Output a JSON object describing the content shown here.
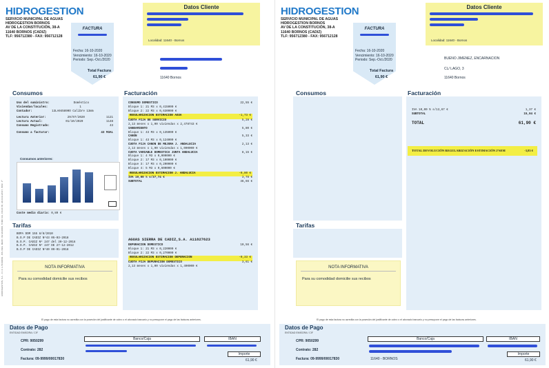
{
  "colors": {
    "brand": "#1f78c8",
    "highlight": "#f3ee44",
    "panel": "#e3eef8",
    "note": "#fbf7c4"
  },
  "header": {
    "logo": "HIDROGESTION",
    "org_lines": [
      "SERVICIO MUNICIPAL DE AGUAS",
      "HIDROGESTION BORNOS",
      "AV DE LA CONSTITUCIÓN, 38-A",
      "11640 BORNOS (CADIZ)",
      "TLF: 956712380 - FAX: 956712128"
    ],
    "factura_title": "FACTURA",
    "fecha": "Fecha: 16-10-2020",
    "vencimiento": "Vencimiento: 16-10-2020",
    "periodo": "Periodo: Sep.-Oct./2020",
    "total_label": "Total Factura",
    "total_value": "61,90 €",
    "datos_cliente_title": "Datos Cliente",
    "localidad": "Localidad: 11640 - Bornos",
    "addr_p1_city": "11640  Bornos",
    "addr_p2_name": "BUENO JIMENEZ, ENCARNACION",
    "addr_p2_street": "CL/ LAGO, 3",
    "addr_p2_city": "11640  Bornos"
  },
  "side_text": "HIDROGESTION, S.A. - C.I.F. A-79449849 - INS. REG. MERC. DE MADRID, TOMO 112, FOLIO 68, HOJA M-26617, INSC. 1ª",
  "consumos": {
    "title": "Consumos",
    "rows": [
      [
        "Uso del suministro:",
        "Doméstico",
        ""
      ],
      [
        "Viviendas/locales:",
        "1",
        ""
      ],
      [
        "Contador:",
        "13LA045890O Calibre 13mm",
        ""
      ],
      [
        "Lectura Anterior:",
        "29/07/2020",
        "1121"
      ],
      [
        "Lectura Actual:",
        "01/10/2020",
        "1148"
      ],
      [
        "Consumo Registrado:",
        "",
        "43"
      ],
      [
        "Consumo a facturar:",
        "",
        "43 M3AL"
      ]
    ],
    "chart_title": "Consumos anteriores:",
    "coste_medio": "Coste medio diario:",
    "coste_value": "0,89 €"
  },
  "chart_data": {
    "type": "bar",
    "categories": [
      "",
      "",
      "",
      "",
      "",
      ""
    ],
    "values": [
      30,
      22,
      27,
      40,
      52,
      48
    ],
    "title": "Consumos anteriores:",
    "xlabel": "",
    "ylabel": ""
  },
  "facturacion": {
    "title": "Facturación",
    "lines": [
      {
        "t": "CONSUMO DOMESTICO",
        "v": "22,55 €",
        "hl": false
      },
      {
        "t": "Bloque 1:      21 M3 x 0,415000 €",
        "v": "",
        "hl": false
      },
      {
        "t": "Bloque 2:      22 M3 x 0,630000 €",
        "v": "",
        "hl": false
      },
      {
        "t": "REGULARIZACION ESTIMACION AGUA",
        "v": "-1,73 €",
        "hl": true
      },
      {
        "t": "CUOTA FIJA DE SERVICIO",
        "v": "5,28 €",
        "hl": false
      },
      {
        "t": "2,13 meses x 1,00 viviendas x 2,478743 €",
        "v": "",
        "hl": false
      },
      {
        "t": "SANEAMIENTO",
        "v": "5,80 €",
        "hl": false
      },
      {
        "t": "Bloque 1:      43 M3 x 0,135000 €",
        "v": "",
        "hl": false
      },
      {
        "t": "CANON",
        "v": "5,33 €",
        "hl": false
      },
      {
        "t": "Bloque 1:      43 M3 x 0,124000 €",
        "v": "",
        "hl": false
      },
      {
        "t": "CUOTA FIJA CANON DE MEJORA J. ANDALUCIA",
        "v": "2,13 €",
        "hl": false
      },
      {
        "t": "2,13 meses x 1,00 viviendas x 1,000000 €",
        "v": "",
        "hl": false
      },
      {
        "t": "CUOTA VARIABLE DOMESTICA JUNTA ANDALUCIA",
        "v": "8,15 €",
        "hl": false
      },
      {
        "t": "Bloque 1:       4 M3 x 0,000000 €",
        "v": "",
        "hl": false
      },
      {
        "t": "Bloque 2:      17 M3 x 0,100000 €",
        "v": "",
        "hl": false
      },
      {
        "t": "Bloque 3:      17 M3 x 0,200000 €",
        "v": "",
        "hl": false
      },
      {
        "t": "Bloque 4:       5 M3 x 0,600000 €",
        "v": "",
        "hl": false
      },
      {
        "t": "REGULARIZACION ESTIMACION J. ANDALUCIA",
        "v": "-0,80 €",
        "hl": true
      },
      {
        "t": "",
        "v": "",
        "hl": false
      },
      {
        "t": "IVA     10,00 % s/37,74 €",
        "v": "3,78 €",
        "hl": false
      },
      {
        "t": "SUBTOTAL",
        "v": "46,66 €",
        "hl": false
      }
    ],
    "sierra_title": "AGUAS SIERRA DE CADIZ,S.A. A11827623",
    "sierra_lines": [
      {
        "t": "DEPURACION DOMESTICO",
        "v": "10,56 €",
        "hl": false
      },
      {
        "t": "Bloque 1:      21 M3 x 0,220000 €",
        "v": "",
        "hl": false
      },
      {
        "t": "Bloque 2:      22 M3 x 0,270000 €",
        "v": "",
        "hl": false
      },
      {
        "t": "REGULARIZACION ESTIMACION DEPURACION",
        "v": "-0,33 €",
        "hl": true
      },
      {
        "t": "CUOTA FIJA DEPURACION DOMESTICO",
        "v": "3,61 €",
        "hl": false
      },
      {
        "t": "2,13 meses x 1,00 viviendas x 1,400000 €",
        "v": "",
        "hl": false
      }
    ]
  },
  "facturacion_p2": {
    "iva": "IVA     10,00 % s/13,67 €",
    "iva_v": "1,37 €",
    "subtotal": "SUBTOTAL",
    "subtotal_v": "15,04 €",
    "total": "TOTAL",
    "total_v": "61,90 €",
    "devolucion": "TOTAL DEVOLUCIÓN REGULARIZACIÓN ESTIMACIÓN 2ºSEM",
    "devolucion_v": "-3,83 €"
  },
  "tarifas": {
    "title": "Tarifas",
    "lines": [
      "BOPA DOM 155 8/8/2010",
      "B.O.P DE CADIZ Nº43 05-03-2018",
      "B.O.P. CADIZ Nº 247 del 30-12-2016",
      "B.O.P. CADIZ Nº 247 DE 27-12-2012",
      "B.O.P DE CADIZ Nº40 09-01-2018"
    ]
  },
  "nota": {
    "title": "NOTA INFORMATIVA",
    "body": "Para su comodidad domicilie sus recibos"
  },
  "pago": {
    "notice": "El pago de esta factura no acredita con la posesión del justificante de cobro o el abonado bancario y no presupone el pago de las facturas anteriores.",
    "title": "Datos de Pago",
    "sub": "ENTIDAD EMISORA / CIF",
    "cpr": "CPR: 9050299",
    "contrato": "Contrato: 282",
    "factura": "Factura: 09-9999/00017830",
    "banco": "Banco/Caja",
    "iban": "IBAN",
    "importe": "Importe",
    "importe_v": "61,90 €",
    "city_p2": "11640 - BORNOS"
  }
}
